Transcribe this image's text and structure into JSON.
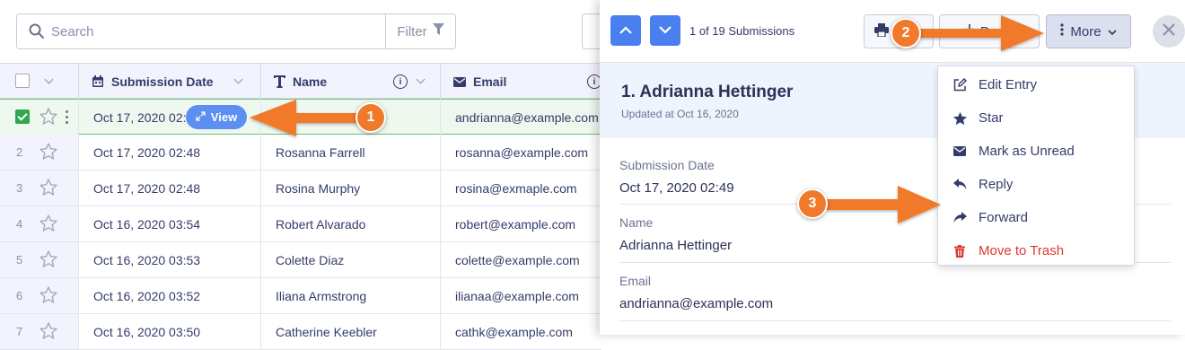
{
  "toolbar": {
    "search_placeholder": "Search",
    "filter_label": "Filter"
  },
  "table": {
    "headers": {
      "submission_date": "Submission Date",
      "name": "Name",
      "email": "Email"
    },
    "view_label": "View",
    "rows": [
      {
        "num": "",
        "date": "Oct 17, 2020 02:49",
        "name": "",
        "email": "andrianna@example.com",
        "selected": true
      },
      {
        "num": "2",
        "date": "Oct 17, 2020 02:48",
        "name": "Rosanna Farrell",
        "email": "rosanna@example.com"
      },
      {
        "num": "3",
        "date": "Oct 17, 2020 02:48",
        "name": "Rosina Murphy",
        "email": "rosina@exmaple.com"
      },
      {
        "num": "4",
        "date": "Oct 16, 2020 03:54",
        "name": "Robert Alvarado",
        "email": "robert@example.com"
      },
      {
        "num": "5",
        "date": "Oct 16, 2020 03:53",
        "name": "Colette Diaz",
        "email": "colette@example.com"
      },
      {
        "num": "6",
        "date": "Oct 16, 2020 03:52",
        "name": "Iliana Armstrong",
        "email": "ilianaa@example.com"
      },
      {
        "num": "7",
        "date": "Oct 16, 2020 03:50",
        "name": "Catherine Keebler",
        "email": "cathk@example.com"
      }
    ]
  },
  "panel": {
    "counter": "1 of 19 Submissions",
    "download_label": "Down",
    "more_label": "More",
    "entry_title": "1. Adrianna Hettinger",
    "entry_updated": "Updated at Oct 16, 2020",
    "fields": [
      {
        "label": "Submission Date",
        "value": "Oct 17, 2020 02:49"
      },
      {
        "label": "Name",
        "value": "Adrianna Hettinger"
      },
      {
        "label": "Email",
        "value": "andrianna@example.com"
      }
    ]
  },
  "dropdown": {
    "items": [
      {
        "label": "Edit Entry",
        "icon": "edit-icon"
      },
      {
        "label": "Star",
        "icon": "star-icon"
      },
      {
        "label": "Mark as Unread",
        "icon": "envelope-icon"
      },
      {
        "label": "Reply",
        "icon": "reply-icon"
      },
      {
        "label": "Forward",
        "icon": "forward-icon"
      },
      {
        "label": "Move to Trash",
        "icon": "trash-icon"
      }
    ]
  },
  "annotations": {
    "badge_1": "1",
    "badge_2": "2",
    "badge_3": "3"
  },
  "colors": {
    "primary": "#4a7ff0",
    "selected_check": "#2fa84f",
    "annotation": "#f07a2a",
    "danger": "#e0382f",
    "header_bg": "#f3f3fe"
  }
}
